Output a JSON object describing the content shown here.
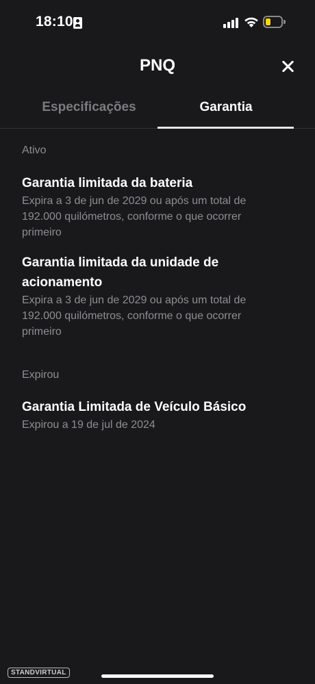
{
  "status_bar": {
    "time": "18:10",
    "battery_color": "#ffd60a"
  },
  "header": {
    "title": "PNQ",
    "close_icon": "close-icon"
  },
  "tabs": [
    {
      "label": "Especificações",
      "active": false
    },
    {
      "label": "Garantia",
      "active": true
    }
  ],
  "sections": {
    "active": {
      "label": "Ativo",
      "items": [
        {
          "title": "Garantia limitada da bateria",
          "subtitle": "Expira a 3 de jun de 2029 ou após um total de 192.000 quilómetros, conforme o que ocorrer primeiro"
        },
        {
          "title": "Garantia limitada da unidade de acionamento",
          "subtitle": "Expira a 3 de jun de 2029 ou após um total de 192.000 quilómetros, conforme o que ocorrer primeiro"
        }
      ]
    },
    "expired": {
      "label": "Expirou",
      "items": [
        {
          "title": "Garantia Limitada de Veículo Básico",
          "subtitle": "Expirou a 19 de jul de 2024"
        }
      ]
    }
  },
  "watermark": "STANDVIRTUAL",
  "colors": {
    "background": "#19191b",
    "muted_text": "#8e8e93",
    "inactive_tab": "#7c7c80"
  }
}
